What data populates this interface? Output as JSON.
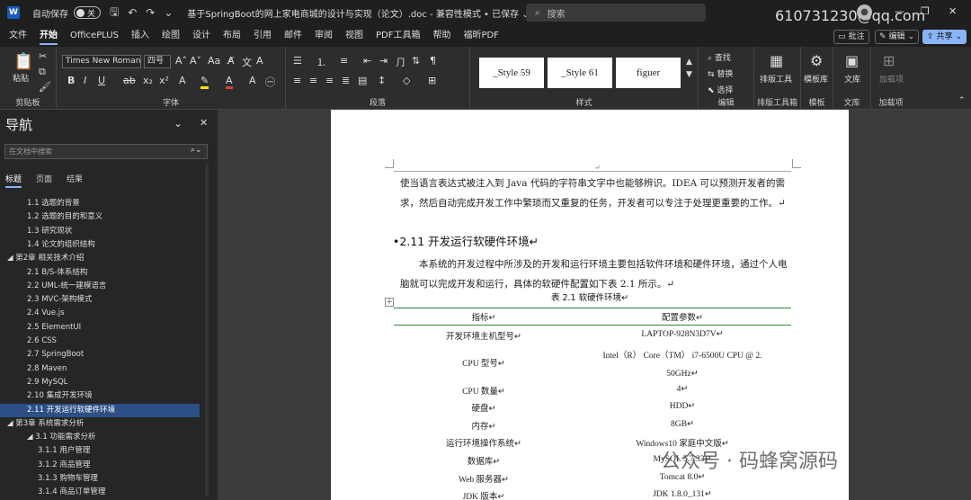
{
  "titlebar": {
    "app_logo": "W",
    "autosave_label": "自动保存",
    "autosave_state": "关",
    "document_title": "基于SpringBoot的网上家电商城的设计与实现（论文）.doc  -  兼容性模式 • 已保存 ⌄",
    "search_placeholder": "搜索",
    "account_email": "610731230@qq.com"
  },
  "menu": {
    "tabs": [
      "文件",
      "开始",
      "OfficePLUS",
      "插入",
      "绘图",
      "设计",
      "布局",
      "引用",
      "邮件",
      "审阅",
      "视图",
      "PDF工具箱",
      "帮助",
      "福昕PDF"
    ],
    "active_tab": "开始",
    "comment_button": "批注",
    "edit_button": "编辑",
    "share_button": "共享"
  },
  "ribbon": {
    "clipboard": {
      "paste": "粘贴",
      "label": "剪贴板"
    },
    "font": {
      "name": "Times New Roman",
      "size": "四号",
      "label": "字体"
    },
    "paragraph_label": "段落",
    "styles": {
      "items": [
        "_Style 59",
        "_Style 61",
        "figuer"
      ],
      "label": "样式"
    },
    "editing": {
      "find": "查找",
      "replace": "替换",
      "select": "选择",
      "label": "编辑"
    },
    "layout_tool": {
      "name": "排版工具",
      "label": "排版工具箱"
    },
    "template": {
      "name": "模板库",
      "label": "模板"
    },
    "library": {
      "name": "文库",
      "label": "文库"
    },
    "addin": {
      "name": "加载项",
      "label": "加载项"
    }
  },
  "navigation": {
    "title": "导航",
    "search_placeholder": "在文档中搜索",
    "tabs": [
      "标题",
      "页面",
      "结果"
    ],
    "items": [
      {
        "text": "1.1  选题的背景",
        "level": 2
      },
      {
        "text": "1.2  选题的目的和意义",
        "level": 2
      },
      {
        "text": "1.3  研究现状",
        "level": 2
      },
      {
        "text": "1.4  论文的组织结构",
        "level": 2
      },
      {
        "text": "◢  第2章  相关技术介绍",
        "level": 1
      },
      {
        "text": "2.1  B/S-体系结构",
        "level": 2
      },
      {
        "text": "2.2  UML-统一建模语言",
        "level": 2
      },
      {
        "text": "2.3  MVC-架构模式",
        "level": 2
      },
      {
        "text": "2.4  Vue.js",
        "level": 2
      },
      {
        "text": "2.5  ElementUI",
        "level": 2
      },
      {
        "text": "2.6  CSS",
        "level": 2
      },
      {
        "text": "2.7 SpringBoot",
        "level": 2
      },
      {
        "text": "2.8   Maven",
        "level": 2
      },
      {
        "text": "2.9  MySQL",
        "level": 2
      },
      {
        "text": "2.10  集成开发环境",
        "level": 2
      },
      {
        "text": "2.11  开发运行软硬件环境",
        "level": 2,
        "selected": true
      },
      {
        "text": "◢  第3章  系统需求分析",
        "level": 1
      },
      {
        "text": "◢  3.1  功能需求分析",
        "level": 2
      },
      {
        "text": "3.1.1  用户管理",
        "level": 3
      },
      {
        "text": "3.1.2  商品管理",
        "level": 3
      },
      {
        "text": "3.1.3  购物车管理",
        "level": 3
      },
      {
        "text": "3.1.4  商品订单管理",
        "level": 3
      }
    ]
  },
  "document": {
    "para1": "使当语言表达式被注入到 Java 代码的字符串文字中也能够辨识。IDEA 可以预测开发者的需求，然后自动完成开发工作中繁琐而又重复的任务，开发者可以专注于处理更重要的工作。↵",
    "heading": "•2.11   开发运行软硬件环境↵",
    "para2": "本系统的开发过程中所涉及的开发和运行环境主要包括软件环境和硬件环境，通过个人电脑就可以完成开发和运行，具体的软硬件配置如下表 2.1 所示。↵",
    "table_caption": "表 2.1  软硬件环境↵",
    "table_header": [
      "指标↵",
      "配置参数↵"
    ],
    "table_rows": [
      [
        "开发环境主机型号↵",
        "LAPTOP-928N3D7V↵"
      ],
      [
        "CPU 型号↵",
        "Intel（R） Core（TM） i7-6500U  CPU  @ 2. 50GHz↵"
      ],
      [
        "CPU 数量↵",
        "4↵"
      ],
      [
        "硬盘↵",
        "HDD↵"
      ],
      [
        "内存↵",
        "8GB↵"
      ],
      [
        "运行环境操作系统↵",
        "Windows10 家庭中文版↵"
      ],
      [
        "数据库↵",
        "MySQL 5.7.33↵"
      ],
      [
        "Web 服务器↵",
        "Tomcat 8.0↵"
      ],
      [
        "JDK 版本↵",
        "JDK 1.8.0_131↵"
      ]
    ]
  },
  "watermark": "公众号 · 码蜂窝源码"
}
